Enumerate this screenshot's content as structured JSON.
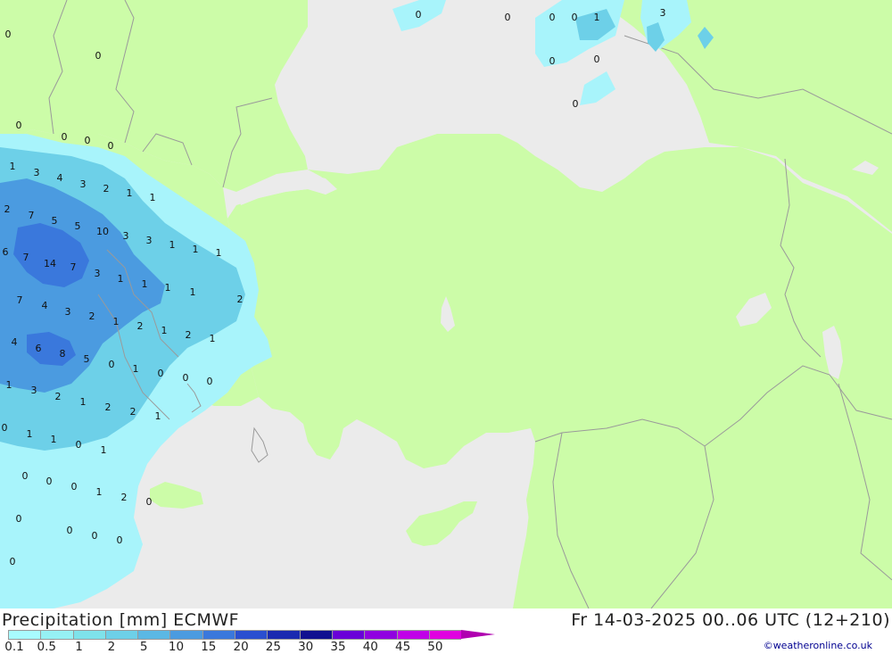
{
  "title": "Precipitation [mm] ECMWF",
  "valid_time": "Fr 14-03-2025 00..06 UTC (12+210)",
  "credit": "©weatheronline.co.uk",
  "legend": {
    "labels": [
      "0.1",
      "0.5",
      "1",
      "2",
      "5",
      "10",
      "15",
      "20",
      "25",
      "30",
      "35",
      "40",
      "45",
      "50"
    ],
    "colors": [
      "#a8fbff",
      "#96f1f4",
      "#7ee2ea",
      "#6dd0e8",
      "#5bb8e4",
      "#4b9be0",
      "#3a78dc",
      "#2a4fd0",
      "#1a2ab0",
      "#101090",
      "#6a00d8",
      "#9000e0",
      "#c000e8",
      "#e000e0"
    ],
    "arrow_color": "#b000b0"
  },
  "colors": {
    "sea": "#ebebeb",
    "land": "#ccfca8",
    "border": "#9a9a9a",
    "precip_light": "#a8f4fb",
    "precip_mid": "#6dd0e8",
    "precip_heavy": "#4b9be0",
    "precip_max": "#3a78dc"
  },
  "precip_values": {
    "black_sea": [
      "0",
      "0",
      "0",
      "0",
      "1",
      "3",
      "0",
      "0",
      "0"
    ],
    "north_balkans": [
      "0",
      "0",
      "0",
      "0",
      "0",
      "0"
    ],
    "greece": [
      "1",
      "3",
      "4",
      "3",
      "2",
      "1",
      "1",
      "2",
      "7",
      "5",
      "5",
      "10",
      "3",
      "3",
      "1",
      "1",
      "1",
      "6",
      "7",
      "14",
      "7",
      "3",
      "1",
      "1",
      "1",
      "1",
      "2",
      "7",
      "4",
      "3",
      "2",
      "1",
      "2",
      "1",
      "2",
      "1",
      "4",
      "6",
      "8",
      "5",
      "0",
      "1",
      "0",
      "0",
      "0",
      "1",
      "3",
      "2",
      "1",
      "2",
      "2",
      "1"
    ],
    "south": [
      "0",
      "1",
      "1",
      "0",
      "1",
      "0",
      "0",
      "0",
      "1",
      "2",
      "0",
      "0",
      "0",
      "0",
      "0",
      "0"
    ]
  }
}
